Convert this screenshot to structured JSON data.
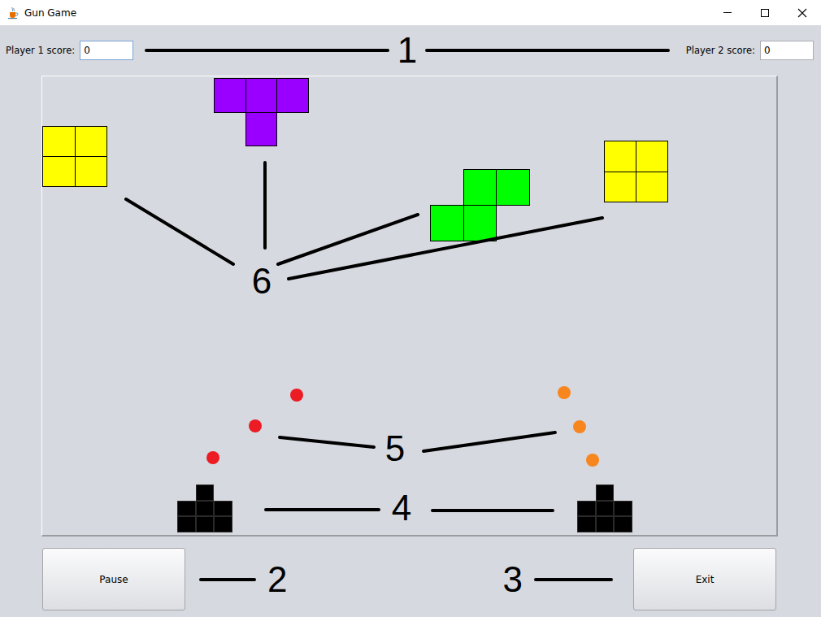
{
  "window": {
    "title": "Gun Game"
  },
  "scores": [
    {
      "label": "Player 1 score:",
      "value": "0",
      "focused": true
    },
    {
      "label": "Player 2 score:",
      "value": "0",
      "focused": false
    }
  ],
  "board": {
    "pieces": [
      {
        "kind": "O",
        "color": "#ffff00"
      },
      {
        "kind": "T",
        "color": "#9900ff"
      },
      {
        "kind": "S",
        "color": "#00ff00"
      },
      {
        "kind": "O",
        "color": "#ffff00"
      }
    ],
    "bullets": [
      {
        "color": "#ec1c24"
      },
      {
        "color": "#ec1c24"
      },
      {
        "color": "#ec1c24"
      },
      {
        "color": "#f7861f"
      },
      {
        "color": "#f7861f"
      },
      {
        "color": "#f7861f"
      }
    ]
  },
  "buttons": [
    "Pause",
    "Exit"
  ],
  "annotations": [
    "1",
    "2",
    "3",
    "4",
    "5",
    "6"
  ]
}
